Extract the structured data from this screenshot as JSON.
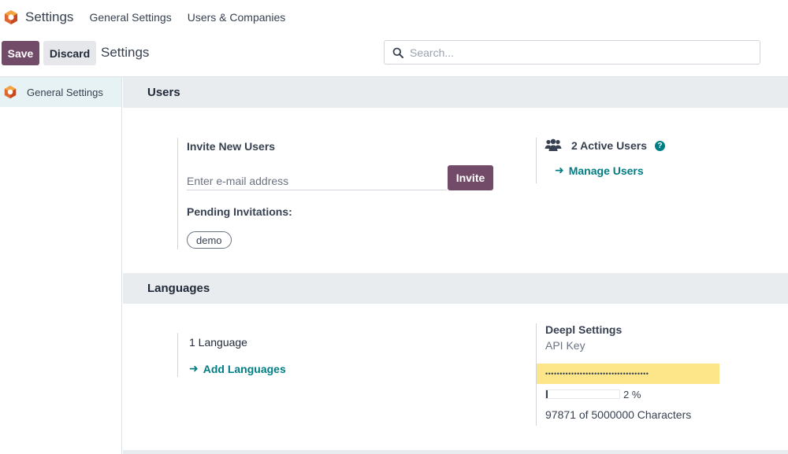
{
  "app": {
    "title": "Settings",
    "nav": [
      "General Settings",
      "Users & Companies"
    ]
  },
  "control": {
    "save_label": "Save",
    "discard_label": "Discard",
    "breadcrumb": "Settings",
    "search_placeholder": "Search..."
  },
  "sidebar": {
    "items": [
      {
        "label": "General Settings",
        "icon": "odoo-app-icon",
        "active": true
      }
    ]
  },
  "sections": {
    "users": {
      "title": "Users",
      "invite_title": "Invite New Users",
      "email_placeholder": "Enter e-mail address",
      "invite_label": "Invite",
      "pending_title": "Pending Invitations:",
      "pending": [
        "demo"
      ],
      "active_users": "2 Active Users",
      "manage_users": "Manage Users"
    },
    "languages": {
      "title": "Languages",
      "count": "1 Language",
      "add_languages": "Add Languages",
      "deepl_title": "Deepl Settings",
      "api_key_label": "API Key",
      "api_key_value": "••••••••••••••••••••••••••••••••••••",
      "usage_percent": "2 %",
      "usage_fraction": 0.02,
      "usage_text": "97871 of 5000000 Characters"
    }
  },
  "colors": {
    "primary": "#714b67",
    "link": "#017e84",
    "section_bg": "#e9ecef",
    "sidebar_active": "#e6f2f3",
    "api_highlight": "#fde68a"
  }
}
